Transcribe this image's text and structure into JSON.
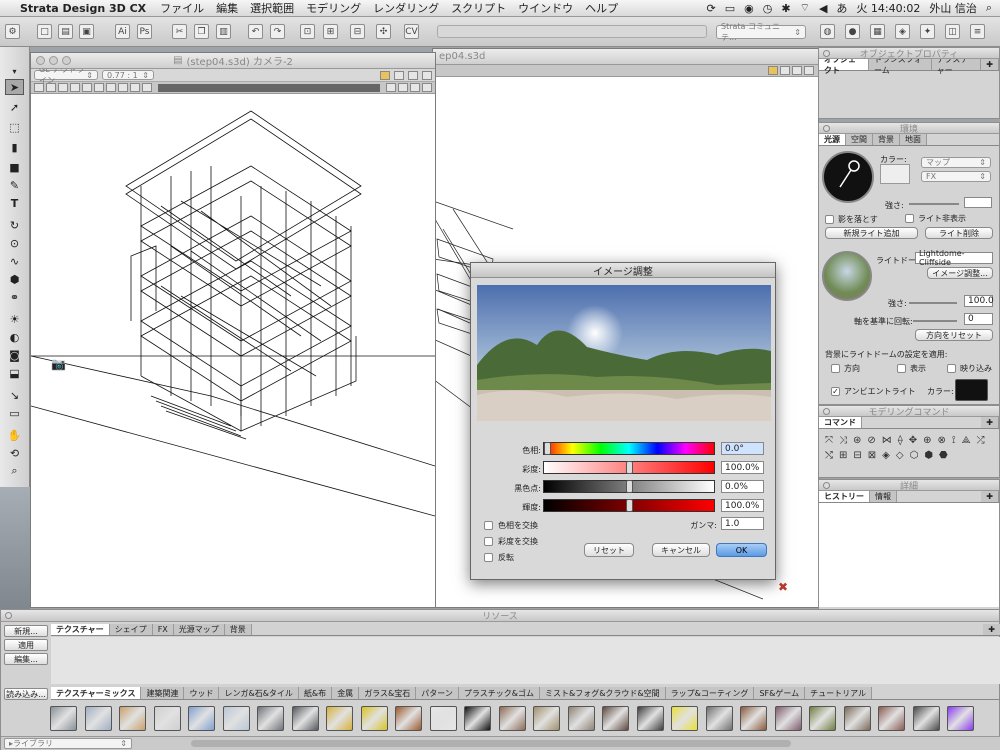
{
  "menubar": {
    "app": "Strata Design 3D CX",
    "items": [
      "ファイル",
      "編集",
      "選択範囲",
      "モデリング",
      "レンダリング",
      "スクリプト",
      "ウインドウ",
      "ヘルプ"
    ],
    "right": {
      "input_mode": "あ",
      "clock": "火 14:40:02",
      "user": "外山 信治"
    }
  },
  "toolbar": {
    "community": "Strata コミュニテ..."
  },
  "modeling_window": {
    "title": "(step04.s3d) カメラ-2",
    "view_mode": "GL アウトライン",
    "zoom": "0.77 : 1",
    "back_title": "ep04.s3d"
  },
  "dialog": {
    "title": "イメージ調整",
    "sliders": [
      {
        "label": "色相:",
        "value": "0.0°",
        "pos": 0.0
      },
      {
        "label": "彩度:",
        "value": "100.0%",
        "pos": 0.5
      },
      {
        "label": "黒色点:",
        "value": "0.0%",
        "pos": 0.5
      },
      {
        "label": "輝度:",
        "value": "100.0%",
        "pos": 0.5
      }
    ],
    "gamma_label": "ガンマ:",
    "gamma_value": "1.0",
    "checks": [
      "色相を交換",
      "彩度を交換",
      "反転"
    ],
    "reset": "リセット",
    "cancel": "キャンセル",
    "ok": "OK"
  },
  "object_props": {
    "title": "オブジェクトプロパティ",
    "tabs": [
      "オブジェクト",
      "トランスフォーム",
      "テクスチャー"
    ]
  },
  "env": {
    "title": "環境",
    "tabs": [
      "光源",
      "空間",
      "背景",
      "地面"
    ],
    "color_label": "カラー:",
    "map_select": "マップ",
    "fx_select": "FX",
    "intensity_label": "強さ:",
    "shadow": "影を落とす",
    "hide_light": "ライト非表示",
    "add_light": "新規ライト追加",
    "delete_light": "ライト削除",
    "lightdome_label": "ライトドーム:",
    "lightdome_value": "Lightdome-Cliffside",
    "image_adjust": "イメージ調整...",
    "strength_label": "強さ:",
    "strength_value": "100.0",
    "rotate_label": "軸を基準に回転:",
    "rotate_value": "0",
    "reset_dir": "方向をリセット",
    "apply_bg": "背景にライトドームの設定を適用:",
    "bg_opts": [
      "方向",
      "表示",
      "映り込み"
    ],
    "ambient": "アンビエントライト",
    "ambient_color": "カラー:"
  },
  "modeling_cmd": {
    "title": "モデリングコマンド",
    "tab": "コマンド"
  },
  "details": {
    "title": "詳細",
    "tabs": [
      "ヒストリー",
      "情報"
    ]
  },
  "resources": {
    "title": "リソース",
    "side_buttons": [
      "新規...",
      "適用",
      "編集..."
    ],
    "tabs": [
      "テクスチャー",
      "シェイプ",
      "FX",
      "光源マップ",
      "背景"
    ],
    "import": "読み込み...",
    "categories": [
      "テクスチャーミックス",
      "建築関連",
      "ウッド",
      "レンガ&石&タイル",
      "紙&布",
      "金属",
      "ガラス&宝石",
      "パターン",
      "プラスチック&ゴム",
      "ミスト&フォグ&クラウド&空間",
      "ラップ&コーティング",
      "SF&ゲーム",
      "チュートリアル"
    ],
    "library": "▸ライブラリ",
    "swatch_colors": [
      "#8a9198",
      "#9fb0c4",
      "#c9a06a",
      "#cfcfcf",
      "#7f9fd0",
      "#b9c6d6",
      "#6f7379",
      "#55595e",
      "#d5b13c",
      "#d9c323",
      "#9b5a2d",
      "#e6e6e6",
      "#111111",
      "#8d6a55",
      "#a08f6a",
      "#8e8275",
      "#5e4a3f",
      "#3d3d3d",
      "#e8e03a",
      "#6f6f6f",
      "#8a5a3c",
      "#7d5b6c",
      "#6f8040",
      "#7a6a5a",
      "#8a5a52",
      "#4a4a4a",
      "#8a3cf0"
    ]
  }
}
